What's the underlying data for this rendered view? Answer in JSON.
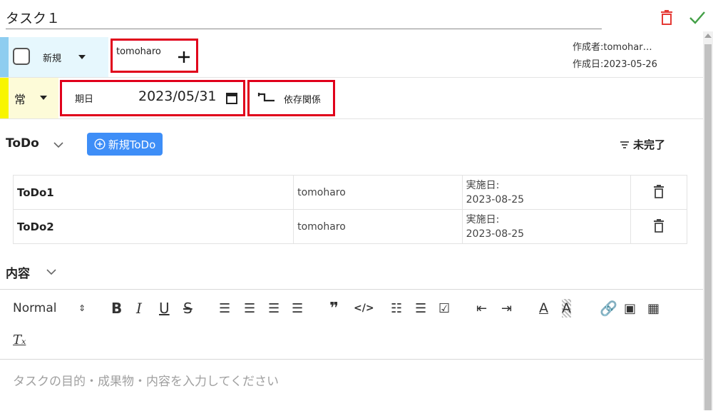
{
  "task": {
    "title": "タスク１",
    "status": "新規",
    "assignee": "tomoharo",
    "frequency": "常",
    "due_label": "期日",
    "due_value": "2023/05/31",
    "dependency_label": "依存関係",
    "creator": "作成者:tomohar…",
    "created": "作成日:2023-05-26"
  },
  "todo": {
    "heading": "ToDo",
    "new_button": "新規ToDo",
    "filter": "未完了",
    "rows": [
      {
        "name": "ToDo1",
        "user": "tomoharo",
        "date_label": "実施日:",
        "date": "2023-08-25"
      },
      {
        "name": "ToDo2",
        "user": "tomoharo",
        "date_label": "実施日:",
        "date": "2023-08-25"
      }
    ]
  },
  "content": {
    "heading": "内容",
    "format": "Normal",
    "placeholder": "タスクの目的・成果物・内容を入力してください"
  },
  "colors": {
    "accent_blue": "#3e8ef7",
    "delete_red": "#e53935",
    "confirm_green": "#43a047",
    "status_bar": "#8ecdf0",
    "frequency_bar": "#f8f500",
    "highlight_box": "#e0001b"
  }
}
